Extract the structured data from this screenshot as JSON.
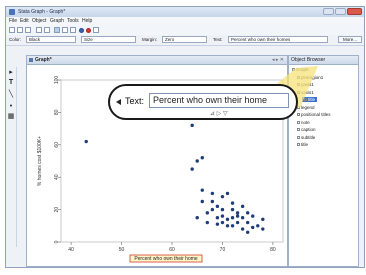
{
  "window": {
    "title": "Stata Graph - Graph*"
  },
  "menu": [
    "File",
    "Edit",
    "Object",
    "Graph",
    "Tools",
    "Help"
  ],
  "propbar": {
    "color_label": "Color:",
    "color_value": "Black",
    "size_value": "Size",
    "margin_label": "Margin:",
    "margin_value": "Zero",
    "text_label": "Text:",
    "text_value": "Percent who own their homes",
    "more_label": "More..."
  },
  "graph_tab": {
    "label": "Graph*"
  },
  "tools": [
    "pointer",
    "text",
    "line",
    "marker",
    "grid"
  ],
  "object_browser": {
    "title": "Object Browser",
    "nodes": [
      {
        "label": "Graph",
        "depth": 0
      },
      {
        "label": "plotregion1",
        "depth": 1
      },
      {
        "label": "yaxis1",
        "depth": 1
      },
      {
        "label": "xaxis1",
        "depth": 1
      },
      {
        "label": "title",
        "depth": 2,
        "selected": true
      },
      {
        "label": "legend",
        "depth": 1
      },
      {
        "label": "positional titles",
        "depth": 1
      },
      {
        "label": "note",
        "depth": 1
      },
      {
        "label": "caption",
        "depth": 1
      },
      {
        "label": "subtitle",
        "depth": 1
      },
      {
        "label": "title",
        "depth": 1
      }
    ]
  },
  "callout": {
    "label": "Text:",
    "value": "Percent who own their home"
  },
  "chart_data": {
    "type": "scatter",
    "xlabel": "Percent who own their home",
    "ylabel": "% homes cost $100K+",
    "xlim": [
      38,
      82
    ],
    "ylim": [
      0,
      100
    ],
    "xticks": [
      40,
      50,
      60,
      70,
      80
    ],
    "yticks": [
      0,
      20,
      40,
      60,
      80,
      100
    ],
    "points": [
      [
        43,
        62
      ],
      [
        62,
        88
      ],
      [
        64,
        72
      ],
      [
        65,
        50
      ],
      [
        66,
        52
      ],
      [
        64,
        45
      ],
      [
        66,
        32
      ],
      [
        68,
        30
      ],
      [
        68,
        25
      ],
      [
        70,
        28
      ],
      [
        71,
        30
      ],
      [
        72,
        20
      ],
      [
        72,
        24
      ],
      [
        73,
        18
      ],
      [
        70,
        16
      ],
      [
        69,
        22
      ],
      [
        70,
        12
      ],
      [
        71,
        14
      ],
      [
        72,
        10
      ],
      [
        73,
        12
      ],
      [
        74,
        15
      ],
      [
        74,
        8
      ],
      [
        75,
        12
      ],
      [
        75,
        18
      ],
      [
        76,
        16
      ],
      [
        77,
        10
      ],
      [
        78,
        14
      ],
      [
        71,
        10
      ],
      [
        69,
        15
      ],
      [
        68,
        20
      ],
      [
        67,
        18
      ],
      [
        66,
        25
      ],
      [
        65,
        15
      ],
      [
        70,
        20
      ],
      [
        73,
        16
      ],
      [
        72,
        15
      ],
      [
        76,
        9
      ],
      [
        74,
        22
      ],
      [
        67,
        12
      ],
      [
        69,
        11
      ],
      [
        78,
        8
      ],
      [
        75,
        6
      ]
    ]
  },
  "colors": {
    "marker": "#1f3d7a",
    "title_highlight": "#f6e27a",
    "accent": "#3b6fd0"
  }
}
